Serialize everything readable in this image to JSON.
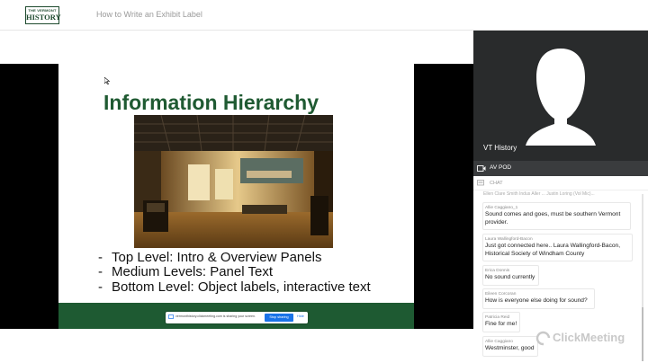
{
  "header": {
    "logo_small": "THE VERMONT",
    "logo_big": "HISTORY",
    "event_title": "How to Write an Exhibit Label"
  },
  "slide": {
    "title": "Information Hierarchy",
    "bullets": [
      "Top Level: Intro & Overview Panels",
      "Medium Levels: Panel Text",
      "Bottom Level: Object labels, interactive text"
    ],
    "dash": "-"
  },
  "share_bar": {
    "text": "vermonthistory.clickmeeting.com is sharing your screen.",
    "stop_label": "Stop sharing",
    "hide_label": "Hide"
  },
  "video": {
    "participant": "VT History"
  },
  "av_bar": {
    "label": "AV POD"
  },
  "chat": {
    "label": "CHAT",
    "cut_line": "Ellen Clare Smith Indus Aller ... Justin Loring (Vol Mic)...",
    "messages": [
      {
        "author": "Allie Caggiano_1",
        "text": "Sound comes and goes, must be southern Vermont provider."
      },
      {
        "author": "Laura Wallingford-Bacon",
        "text": "Just got connected here.. Laura Wallingford-Bacon, Historical Society of Windham County"
      },
      {
        "author": "Erica Donnis",
        "text": "No sound currently"
      },
      {
        "author": "Eileen Corcoran",
        "text": "How is everyone else doing for sound?"
      },
      {
        "author": "Patricia Reid",
        "text": "Fine for me!"
      },
      {
        "author": "Allie Caggiano",
        "text": "Westminster, good"
      }
    ]
  },
  "watermark": {
    "text": "ClickMeeting"
  },
  "colors": {
    "slide_green": "#1f5a32",
    "video_bg": "#292b2c",
    "stop_button": "#1a73e8"
  },
  "icons": [
    "cursor-icon",
    "video-camera-icon",
    "chat-icon",
    "clickmeeting-logo-icon",
    "share-screen-icon",
    "avatar-silhouette-icon"
  ]
}
